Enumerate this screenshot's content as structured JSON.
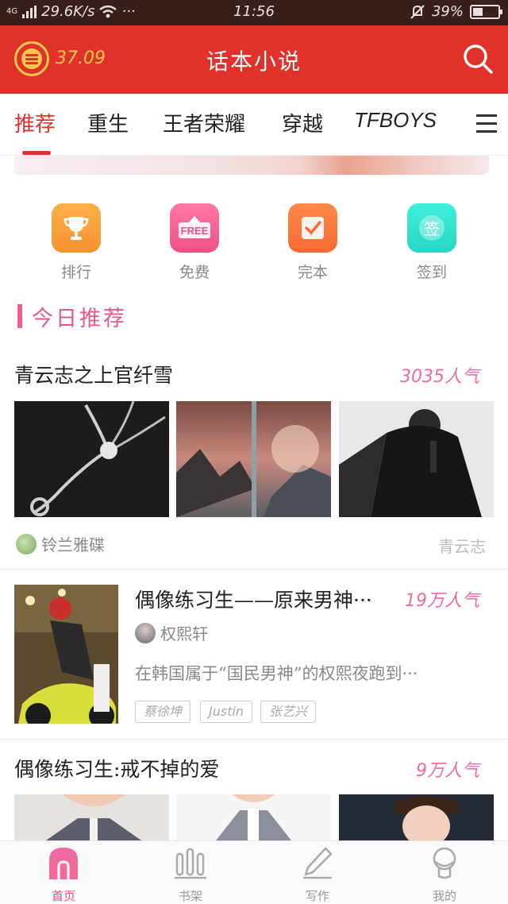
{
  "status_bar": {
    "network_type": "4G",
    "speed": "29.6K/s",
    "more": "···",
    "time": "11:56",
    "battery": "39%",
    "battery_level": 0.39
  },
  "header": {
    "coin_value": "37.09",
    "title": "话本小说",
    "accent_color": "#e0312a",
    "icons": [
      "alarm-coin-icon",
      "search-icon"
    ]
  },
  "tabs": [
    "推荐",
    "重生",
    "王者荣耀",
    "穿越",
    "TFBOYS"
  ],
  "quick_entries": [
    {
      "label": "排行",
      "icon": "trophy-icon",
      "color": "#f7922f"
    },
    {
      "label": "免费",
      "icon": "free-tag-icon",
      "color": "#ef4f86"
    },
    {
      "label": "完本",
      "icon": "check-card-icon",
      "color": "#f76a33"
    },
    {
      "label": "签到",
      "icon": "sign-in-icon",
      "color": "#27d6c6"
    }
  ],
  "section_title": "今日推荐",
  "feature_1": {
    "title": "青云志之上官纤雪",
    "popularity": "3035人气",
    "author": "铃兰雅碟",
    "category": "青云志"
  },
  "feature_2": {
    "title": "偶像练习生——原来男神···",
    "popularity": "19万人气",
    "author": "权熙轩",
    "description": "在韩国属于“国民男神”的权熙夜跑到···",
    "tags": [
      "蔡徐坤",
      "Justin",
      "张艺兴"
    ]
  },
  "feature_3": {
    "title": "偶像练习生:戒不掉的爱",
    "popularity": "9万人气"
  },
  "bottom_nav": [
    {
      "label": "首页",
      "icon": "home-icon",
      "active": true
    },
    {
      "label": "书架",
      "icon": "bookshelf-icon",
      "active": false
    },
    {
      "label": "写作",
      "icon": "pen-icon",
      "active": false
    },
    {
      "label": "我的",
      "icon": "profile-icon",
      "active": false
    }
  ]
}
